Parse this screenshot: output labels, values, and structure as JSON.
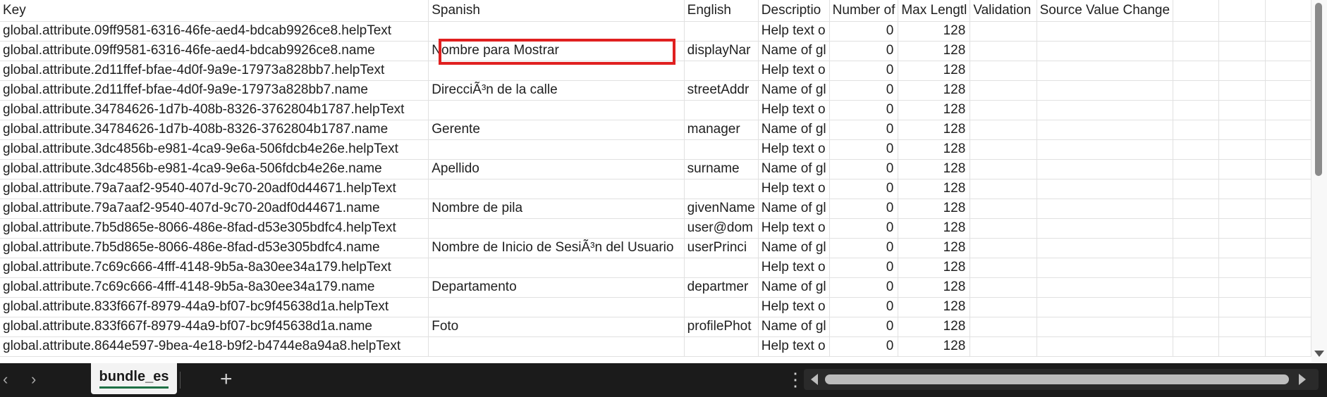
{
  "sheet": {
    "columns": [
      {
        "label": "Key"
      },
      {
        "label": "Spanish"
      },
      {
        "label": "English"
      },
      {
        "label": "Descriptio"
      },
      {
        "label": "Number of"
      },
      {
        "label": "Max Lengtl"
      },
      {
        "label": "Validation"
      },
      {
        "label": "Source Value Change"
      },
      {
        "label": ""
      },
      {
        "label": ""
      },
      {
        "label": ""
      }
    ],
    "rows": [
      {
        "key": "global.attribute.09ff9581-6316-46fe-aed4-bdcab9926ce8.helpText",
        "spanish": "",
        "english": "",
        "description": "Help text o",
        "number": "0",
        "max": "128"
      },
      {
        "key": "global.attribute.09ff9581-6316-46fe-aed4-bdcab9926ce8.name",
        "spanish": "Nombre para Mostrar",
        "english": "displayNar",
        "description": "Name of gl",
        "number": "0",
        "max": "128"
      },
      {
        "key": "global.attribute.2d11ffef-bfae-4d0f-9a9e-17973a828bb7.helpText",
        "spanish": "",
        "english": "",
        "description": "Help text o",
        "number": "0",
        "max": "128"
      },
      {
        "key": "global.attribute.2d11ffef-bfae-4d0f-9a9e-17973a828bb7.name",
        "spanish": "DirecciÃ³n de la calle",
        "english": "streetAddr",
        "description": "Name of gl",
        "number": "0",
        "max": "128"
      },
      {
        "key": "global.attribute.34784626-1d7b-408b-8326-3762804b1787.helpText",
        "spanish": "",
        "english": "",
        "description": "Help text o",
        "number": "0",
        "max": "128"
      },
      {
        "key": "global.attribute.34784626-1d7b-408b-8326-3762804b1787.name",
        "spanish": "Gerente",
        "english": "manager",
        "description": "Name of gl",
        "number": "0",
        "max": "128"
      },
      {
        "key": "global.attribute.3dc4856b-e981-4ca9-9e6a-506fdcb4e26e.helpText",
        "spanish": "",
        "english": "",
        "description": "Help text o",
        "number": "0",
        "max": "128"
      },
      {
        "key": "global.attribute.3dc4856b-e981-4ca9-9e6a-506fdcb4e26e.name",
        "spanish": "Apellido",
        "english": "surname",
        "description": "Name of gl",
        "number": "0",
        "max": "128"
      },
      {
        "key": "global.attribute.79a7aaf2-9540-407d-9c70-20adf0d44671.helpText",
        "spanish": "",
        "english": "",
        "description": "Help text o",
        "number": "0",
        "max": "128"
      },
      {
        "key": "global.attribute.79a7aaf2-9540-407d-9c70-20adf0d44671.name",
        "spanish": "Nombre de pila",
        "english": "givenName",
        "description": "Name of gl",
        "number": "0",
        "max": "128"
      },
      {
        "key": "global.attribute.7b5d865e-8066-486e-8fad-d53e305bdfc4.helpText",
        "spanish": "",
        "english": "user@dom",
        "description": "Help text o",
        "number": "0",
        "max": "128"
      },
      {
        "key": "global.attribute.7b5d865e-8066-486e-8fad-d53e305bdfc4.name",
        "spanish": "Nombre de Inicio de SesiÃ³n del Usuario",
        "english": "userPrinci",
        "description": "Name of gl",
        "number": "0",
        "max": "128"
      },
      {
        "key": "global.attribute.7c69c666-4fff-4148-9b5a-8a30ee34a179.helpText",
        "spanish": "",
        "english": "",
        "description": "Help text o",
        "number": "0",
        "max": "128"
      },
      {
        "key": "global.attribute.7c69c666-4fff-4148-9b5a-8a30ee34a179.name",
        "spanish": "Departamento",
        "english": "departmer",
        "description": "Name of gl",
        "number": "0",
        "max": "128"
      },
      {
        "key": "global.attribute.833f667f-8979-44a9-bf07-bc9f45638d1a.helpText",
        "spanish": "",
        "english": "",
        "description": "Help text o",
        "number": "0",
        "max": "128"
      },
      {
        "key": "global.attribute.833f667f-8979-44a9-bf07-bc9f45638d1a.name",
        "spanish": "Foto",
        "english": "profilePhot",
        "description": "Name of gl",
        "number": "0",
        "max": "128"
      },
      {
        "key": "global.attribute.8644e597-9bea-4e18-b9f2-b4744e8a94a8.helpText",
        "spanish": "",
        "english": "",
        "description": "Help text o",
        "number": "0",
        "max": "128"
      }
    ]
  },
  "tabs": {
    "active_label": "bundle_es",
    "add_label": "+",
    "prev_icon": "chevron-left-icon",
    "next_icon": "chevron-right-icon",
    "more_icon": "more-vertical-icon"
  },
  "colors": {
    "highlight": "#e02020",
    "tab_underline": "#1e7145",
    "bottom_bar": "#1b1b1b"
  }
}
